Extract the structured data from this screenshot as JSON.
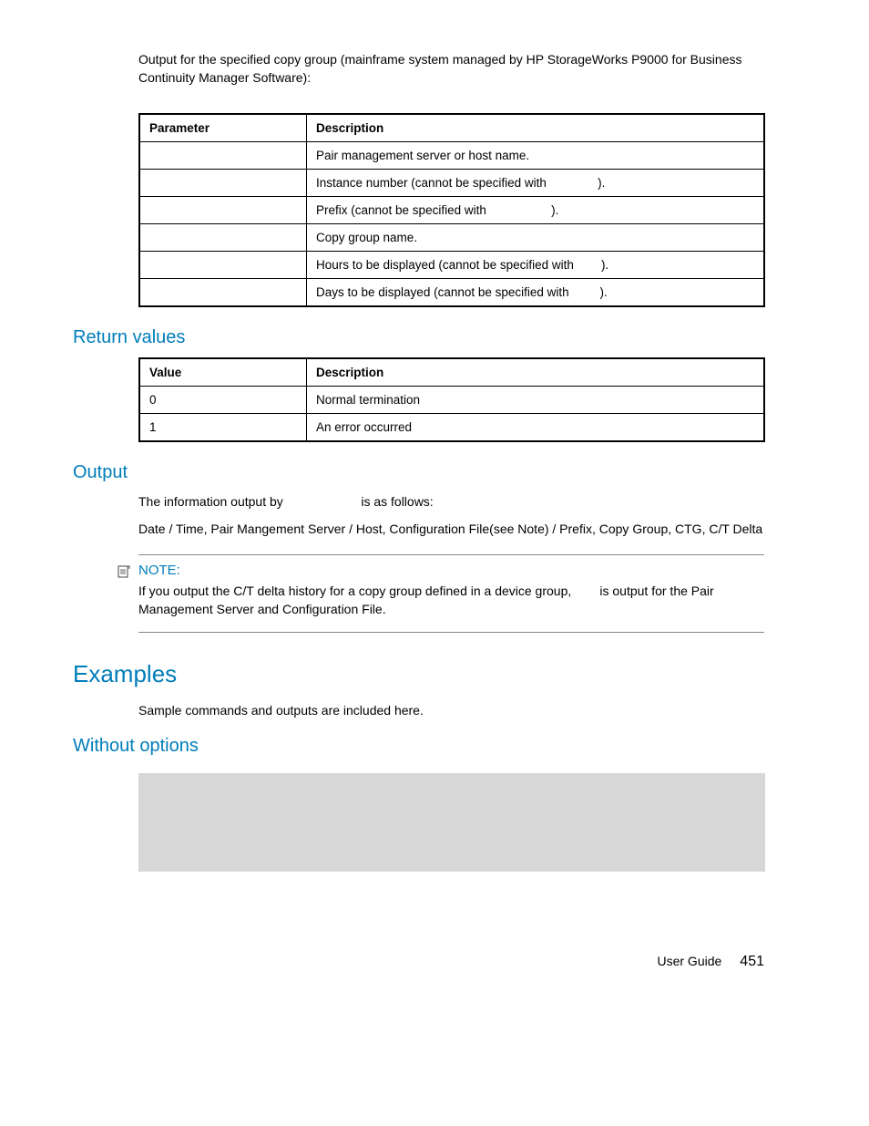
{
  "intro_text": "Output for the specified copy group (mainframe system managed by HP StorageWorks P9000 for Business Continuity Manager Software):",
  "table1": {
    "headers": [
      "Parameter",
      "Description"
    ],
    "rows": [
      {
        "param": "",
        "desc": "Pair management server or host name."
      },
      {
        "param": "",
        "desc_a": "Instance number (cannot be specified with ",
        "desc_b": ")."
      },
      {
        "param": "",
        "desc_a": "Prefix (cannot be specified with ",
        "desc_b": ")."
      },
      {
        "param": "",
        "desc": "Copy group name."
      },
      {
        "param": "",
        "desc_a": "Hours to be displayed (cannot be specified with ",
        "desc_b": ")."
      },
      {
        "param": "",
        "desc_a": "Days to be displayed (cannot be specified with ",
        "desc_b": ")."
      }
    ]
  },
  "return_values": {
    "title": "Return values",
    "headers": [
      "Value",
      "Description"
    ],
    "rows": [
      {
        "value": "0",
        "desc": "Normal termination"
      },
      {
        "value": "1",
        "desc": "An error occurred"
      }
    ]
  },
  "output": {
    "title": "Output",
    "line1_a": "The information output by ",
    "line1_b": " is as follows:",
    "line2": "Date / Time, Pair Mangement Server / Host, Configuration File(see Note) / Prefix, Copy Group, CTG, C/T Delta"
  },
  "note": {
    "title": "NOTE:",
    "body_a": "If you output the C/T delta history for a copy group defined in a device group, ",
    "body_b": " is output for the Pair Management Server and Configuration File."
  },
  "examples": {
    "title": "Examples",
    "intro": "Sample commands and outputs are included here."
  },
  "without_options": {
    "title": "Without options"
  },
  "footer": {
    "label": "User Guide",
    "page": "451"
  }
}
